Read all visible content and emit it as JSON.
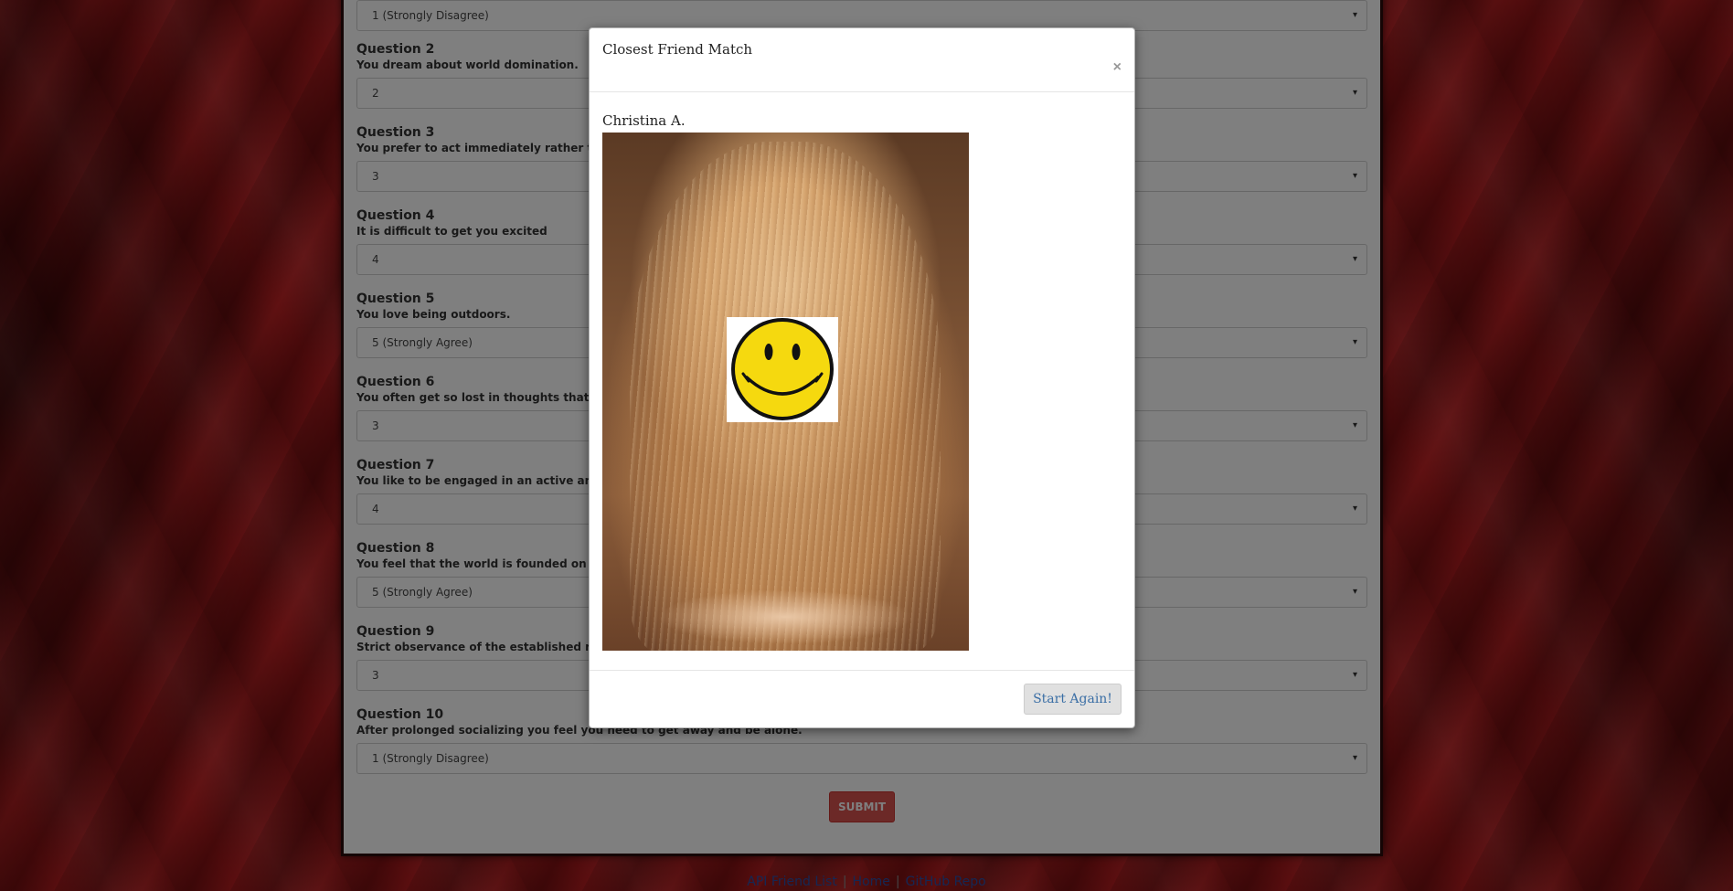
{
  "survey": {
    "partial_top_value": "1 (Strongly Disagree)",
    "questions": [
      {
        "title": "Question 2",
        "text": "You dream about world domination.",
        "value": "2"
      },
      {
        "title": "Question 3",
        "text": "You prefer to act immediately rather than spec",
        "value": "3"
      },
      {
        "title": "Question 4",
        "text": "It is difficult to get you excited",
        "value": "4"
      },
      {
        "title": "Question 5",
        "text": "You love being outdoors.",
        "value": "5 (Strongly Agree)"
      },
      {
        "title": "Question 6",
        "text": "You often get so lost in thoughts that you igno",
        "value": "3"
      },
      {
        "title": "Question 7",
        "text": "You like to be engaged in an active and fast-pa",
        "value": "4"
      },
      {
        "title": "Question 8",
        "text": "You feel that the world is founded on compassi",
        "value": "5 (Strongly Agree)"
      },
      {
        "title": "Question 9",
        "text": "Strict observance of the established rules is lik",
        "value": "3"
      },
      {
        "title": "Question 10",
        "text": "After prolonged socializing you feel you need to get away and be alone.",
        "value": "1 (Strongly Disagree)"
      }
    ],
    "submit_label": "SUBMIT"
  },
  "footer": {
    "api_link": "API Friend List",
    "home_link": "Home",
    "repo_link": "GitHub Repo"
  },
  "modal": {
    "title": "Closest Friend Match",
    "close_glyph": "×",
    "match_name": "Christina A.",
    "start_again_label": "Start Again!"
  },
  "icons": {
    "dropdown_arrow": "▾"
  },
  "colors": {
    "submit_bg": "#d9534f",
    "link": "#2a4fa8",
    "smiley": "#f5d90f"
  }
}
